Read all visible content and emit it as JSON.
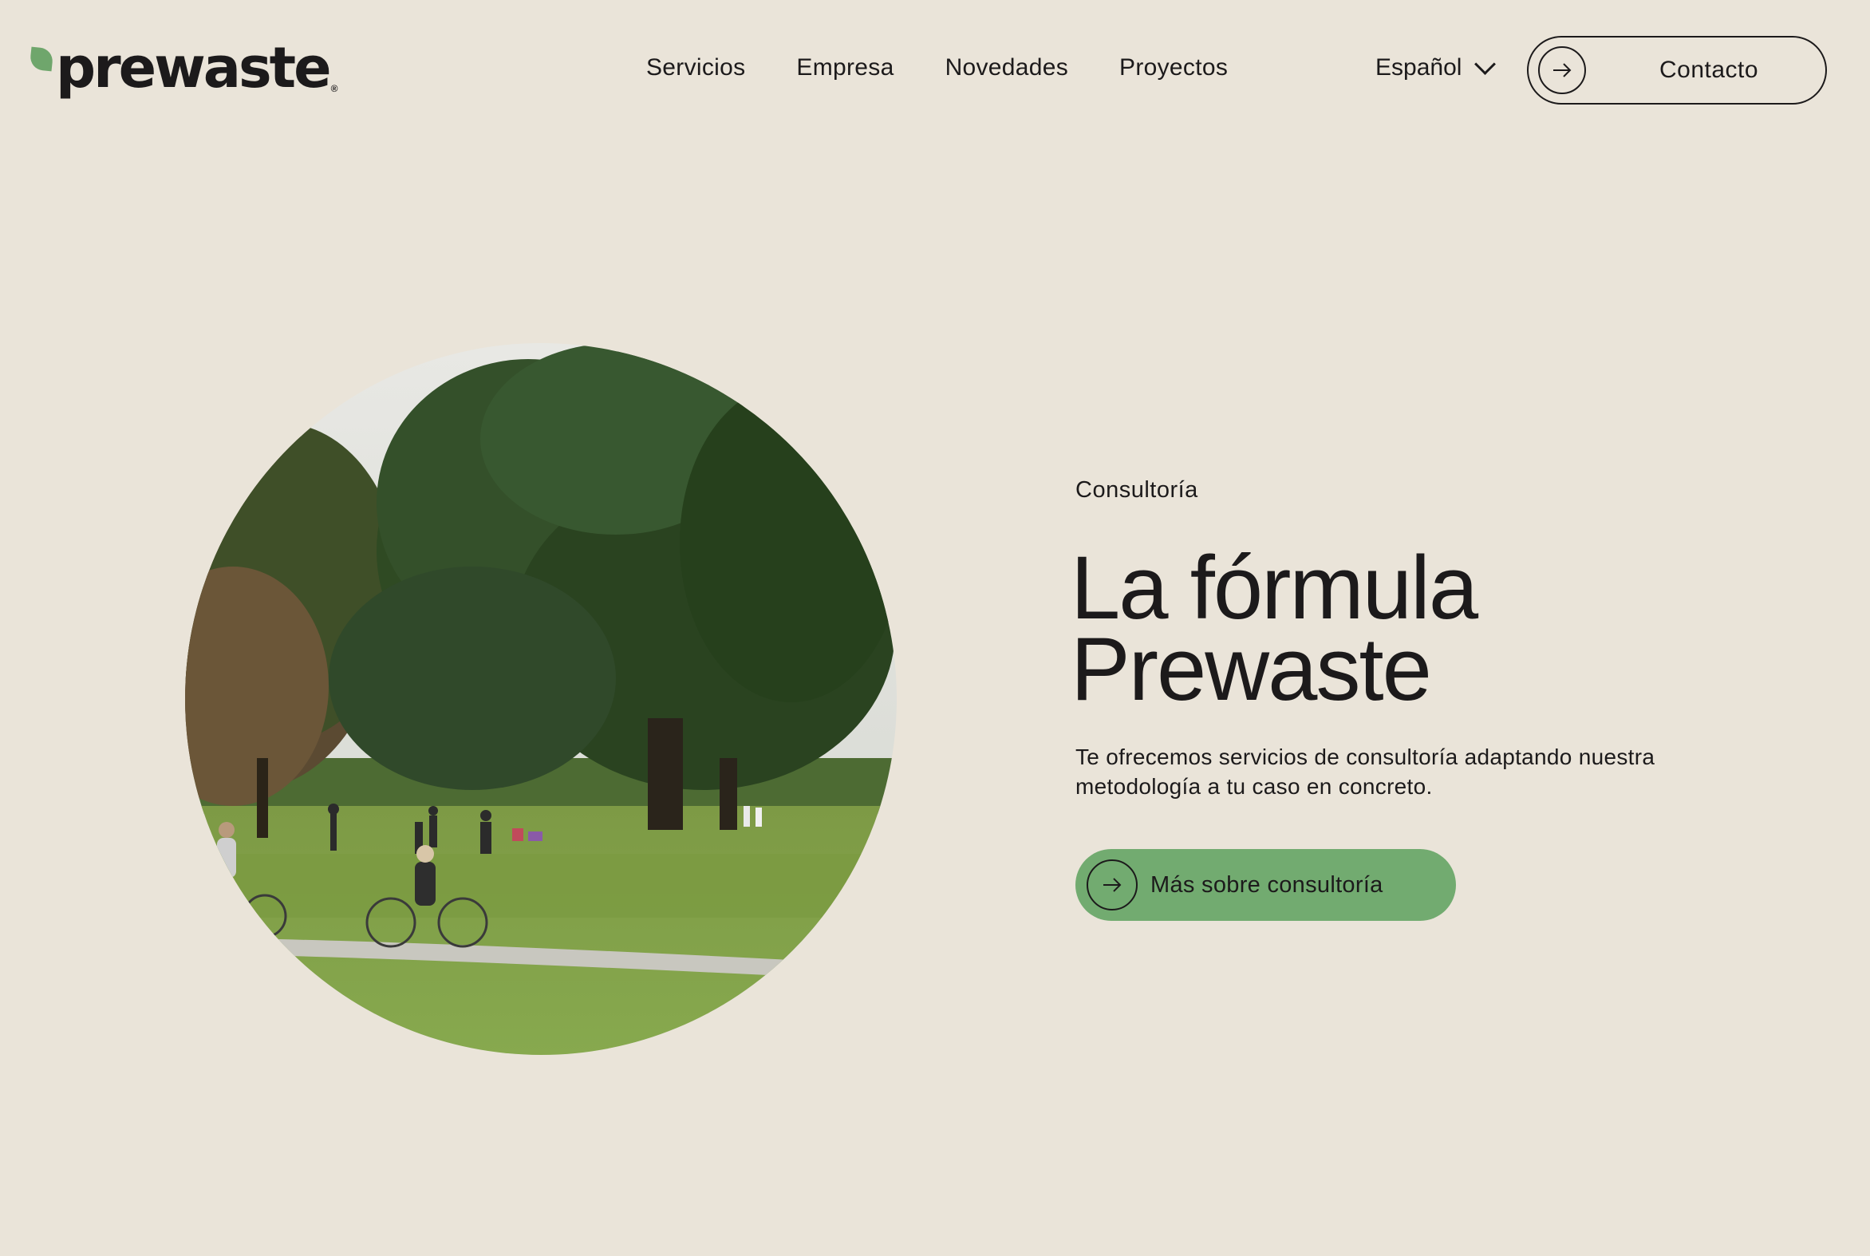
{
  "header": {
    "logo_text": "prewaste",
    "logo_mark": "®",
    "nav": [
      {
        "label": "Servicios"
      },
      {
        "label": "Empresa"
      },
      {
        "label": "Novedades"
      },
      {
        "label": "Proyectos"
      }
    ],
    "language": "Español",
    "contact_label": "Contacto"
  },
  "hero": {
    "eyebrow": "Consultoría",
    "title_line1": "La fórmula",
    "title_line2": "Prewaste",
    "description": "Te ofrecemos servicios de consultoría adaptando nuestra metodología a tu caso en concreto.",
    "cta_label": "Más sobre consultoría"
  },
  "colors": {
    "background": "#eae4d9",
    "text": "#1c1a1b",
    "accent_green": "#72ab70"
  },
  "icons": {
    "arrow": "arrow-right-icon",
    "chevron": "chevron-down-icon",
    "leaf": "leaf-logo-icon"
  }
}
